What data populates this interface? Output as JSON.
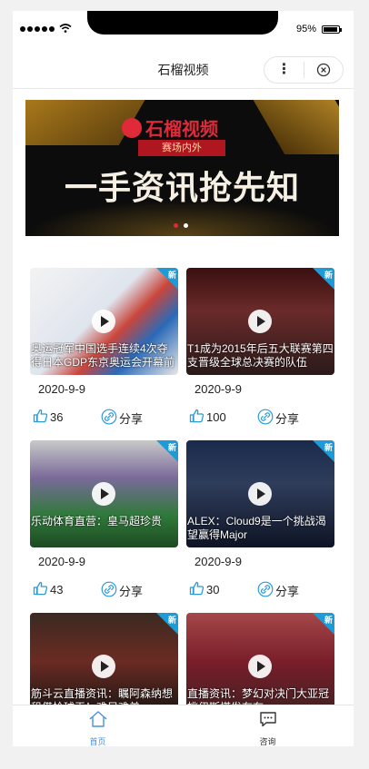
{
  "status": {
    "battery_percent": "95%"
  },
  "navbar": {
    "title": "石榴视频",
    "more_icon": "more-dots-icon",
    "close_icon": "close-circle-icon"
  },
  "banner": {
    "brand": "石榴视频",
    "tag": "赛场内外",
    "headline": "一手资讯抢先知",
    "active_dot": 0,
    "dot_count": 2,
    "colors": {
      "active": "#e02a3a",
      "inactive": "#ffffff"
    }
  },
  "cards": [
    {
      "caption": "奥运冠军中国选手连续4次夺得日本GDP东京奥运会开幕前",
      "date": "2020-9-9",
      "likes": "36",
      "share": "分享",
      "badge": "新"
    },
    {
      "caption": "T1成为2015年后五大联赛第四支晋级全球总决赛的队伍",
      "date": "2020-9-9",
      "likes": "100",
      "share": "分享",
      "badge": "新"
    },
    {
      "caption": "乐动体育直营：皇马超珍贵",
      "date": "2020-9-9",
      "likes": "43",
      "share": "分享",
      "badge": "新"
    },
    {
      "caption": "ALEX：Cloud9是一个挑战渴望赢得Major",
      "date": "2020-9-9",
      "likes": "30",
      "share": "分享",
      "badge": "新"
    },
    {
      "caption": "筋斗云直播资讯：瞩阿森纳想租借恰球王！难兄难弟…",
      "date": "",
      "likes": "",
      "share": "",
      "badge": "新"
    },
    {
      "caption": "直播资讯：梦幻对决门大亚冠挑伊斯塔发布布…",
      "date": "",
      "likes": "",
      "share": "",
      "badge": "新"
    }
  ],
  "tabbar": {
    "items": [
      {
        "label": "首页",
        "icon": "home-icon",
        "active": true
      },
      {
        "label": "咨询",
        "icon": "message-icon",
        "active": false
      }
    ],
    "colors": {
      "active": "#4a90e2",
      "inactive": "#333333"
    }
  }
}
